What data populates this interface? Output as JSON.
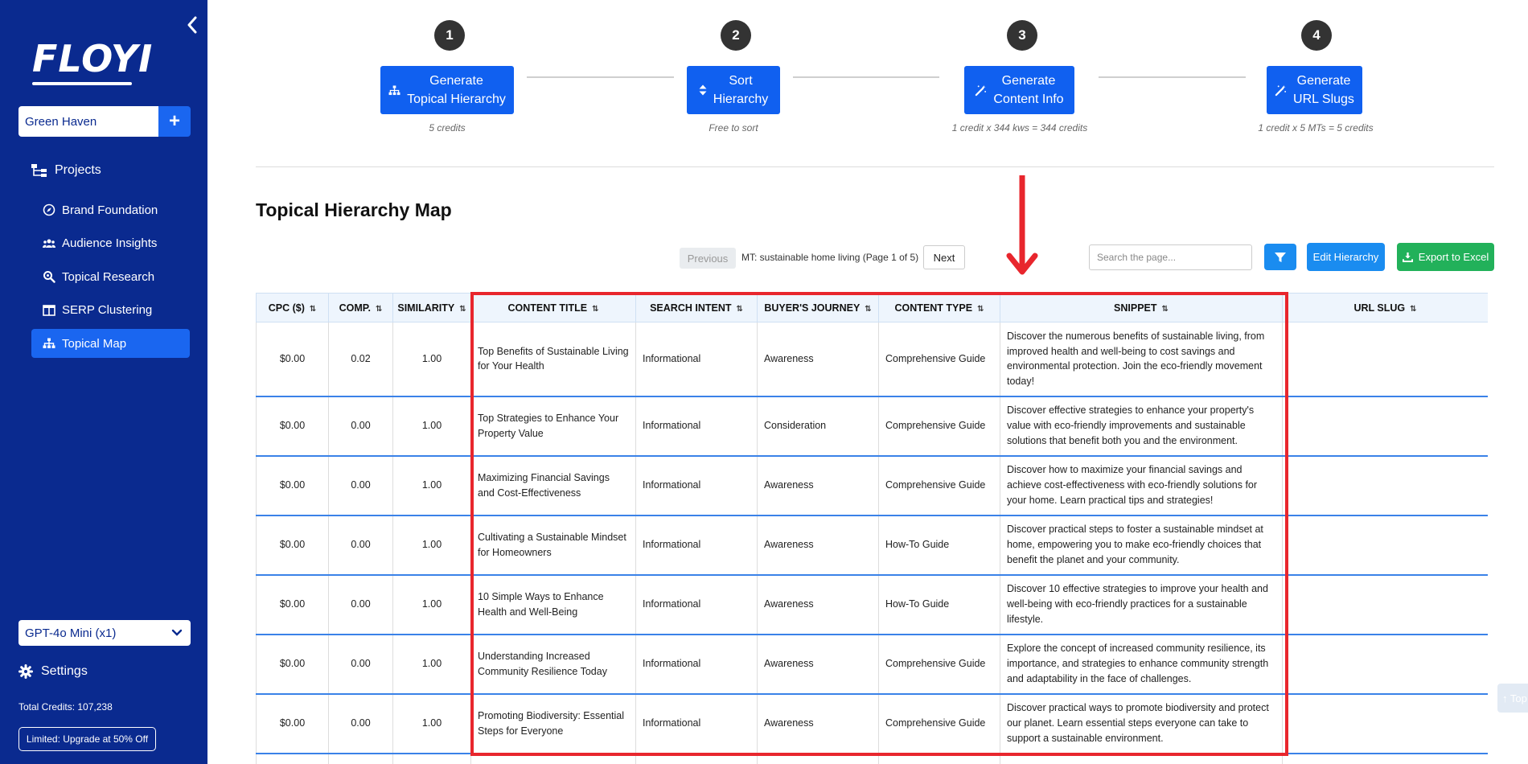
{
  "sidebar": {
    "logo_text": "FLOYI",
    "project_name": "Green Haven",
    "add_label": "+",
    "projects_label": "Projects",
    "nav": [
      {
        "label": "Brand Foundation",
        "icon": "compass-icon"
      },
      {
        "label": "Audience Insights",
        "icon": "users-icon"
      },
      {
        "label": "Topical Research",
        "icon": "search-icon"
      },
      {
        "label": "SERP Clustering",
        "icon": "table-icon"
      },
      {
        "label": "Topical Map",
        "icon": "sitemap-icon"
      }
    ],
    "active_nav": "Topical Map",
    "model": "GPT-4o Mini (x1)",
    "settings_label": "Settings",
    "credits": "Total Credits: 107,238",
    "upgrade": "Limited: Upgrade at 50% Off"
  },
  "steps": [
    {
      "num": "1",
      "line1": "Generate",
      "line2": "Topical Hierarchy",
      "note": "5 credits",
      "icon": "sitemap-icon"
    },
    {
      "num": "2",
      "line1": "Sort",
      "line2": "Hierarchy",
      "note": "Free to sort",
      "icon": "sort-icon"
    },
    {
      "num": "3",
      "line1": "Generate",
      "line2": "Content Info",
      "note": "1 credit x 344 kws = 344 credits",
      "icon": "magic-wand-icon"
    },
    {
      "num": "4",
      "line1": "Generate",
      "line2": "URL Slugs",
      "note": "1 credit x 5 MTs = 5 credits",
      "icon": "magic-wand-icon"
    }
  ],
  "page_title": "Topical Hierarchy Map",
  "pager": {
    "prev": "Previous",
    "info": "MT: sustainable home living (Page 1 of 5)",
    "next": "Next"
  },
  "toolbar": {
    "search_placeholder": "Search the page...",
    "edit": "Edit Hierarchy",
    "export": "Export to Excel"
  },
  "table": {
    "columns": [
      "CPC ($)",
      "COMP.",
      "SIMILARITY",
      "CONTENT TITLE",
      "SEARCH INTENT",
      "BUYER'S JOURNEY",
      "CONTENT TYPE",
      "SNIPPET",
      "URL SLUG"
    ],
    "rows": [
      [
        "$0.00",
        "0.02",
        "1.00",
        "Top Benefits of Sustainable Living for Your Health",
        "Informational",
        "Awareness",
        "Comprehensive Guide",
        "Discover the numerous benefits of sustainable living, from improved health and well-being to cost savings and environmental protection. Join the eco-friendly movement today!",
        ""
      ],
      [
        "$0.00",
        "0.00",
        "1.00",
        "Top Strategies to Enhance Your Property Value",
        "Informational",
        "Consideration",
        "Comprehensive Guide",
        "Discover effective strategies to enhance your property's value with eco-friendly improvements and sustainable solutions that benefit both you and the environment.",
        ""
      ],
      [
        "$0.00",
        "0.00",
        "1.00",
        "Maximizing Financial Savings and Cost-Effectiveness",
        "Informational",
        "Awareness",
        "Comprehensive Guide",
        "Discover how to maximize your financial savings and achieve cost-effectiveness with eco-friendly solutions for your home. Learn practical tips and strategies!",
        ""
      ],
      [
        "$0.00",
        "0.00",
        "1.00",
        "Cultivating a Sustainable Mindset for Homeowners",
        "Informational",
        "Awareness",
        "How-To Guide",
        "Discover practical steps to foster a sustainable mindset at home, empowering you to make eco-friendly choices that benefit the planet and your community.",
        ""
      ],
      [
        "$0.00",
        "0.00",
        "1.00",
        "10 Simple Ways to Enhance Health and Well-Being",
        "Informational",
        "Awareness",
        "How-To Guide",
        "Discover 10 effective strategies to improve your health and well-being with eco-friendly practices for a sustainable lifestyle.",
        ""
      ],
      [
        "$0.00",
        "0.00",
        "1.00",
        "Understanding Increased Community Resilience Today",
        "Informational",
        "Awareness",
        "Comprehensive Guide",
        "Explore the concept of increased community resilience, its importance, and strategies to enhance community strength and adaptability in the face of challenges.",
        ""
      ],
      [
        "$0.00",
        "0.00",
        "1.00",
        "Promoting Biodiversity: Essential Steps for Everyone",
        "Informational",
        "Awareness",
        "Comprehensive Guide",
        "Discover practical ways to promote biodiversity and protect our planet. Learn essential steps everyone can take to support a sustainable environment.",
        ""
      ]
    ]
  },
  "back_to_top": "↑ Top",
  "colors": {
    "sidebar": "#0a2a8f",
    "primary": "#1060f0",
    "accent": "#1a8cf0",
    "success": "#22b15a",
    "highlight": "#e8262d"
  }
}
